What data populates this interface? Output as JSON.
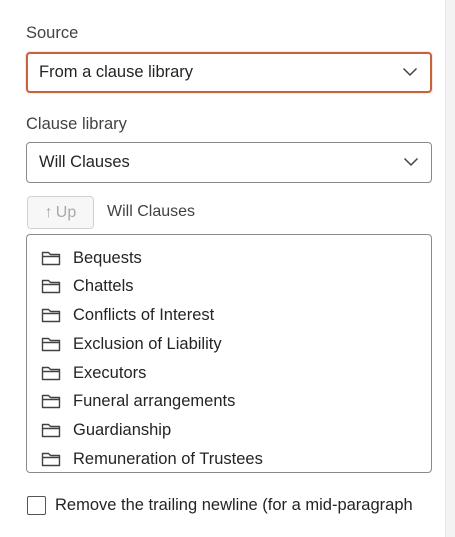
{
  "source": {
    "label": "Source",
    "selected": "From a clause library"
  },
  "clause_library": {
    "label": "Clause library",
    "selected": "Will Clauses"
  },
  "navigation": {
    "up_label": "Up",
    "up_arrow": "↑",
    "current_folder": "Will Clauses"
  },
  "folders": [
    "Bequests",
    "Chattels",
    "Conflicts of Interest",
    "Exclusion of Liability",
    "Executors",
    "Funeral arrangements",
    "Guardianship",
    "Remuneration of Trustees"
  ],
  "options": {
    "remove_trailing_newline": {
      "label": "Remove the trailing newline (for a mid-paragraph",
      "checked": false
    }
  },
  "icons": {
    "folder": "folder-icon",
    "dropdown": "chevron-down-icon"
  },
  "colors": {
    "focus_border": "#c8623b",
    "disabled_text": "#a8a8a8"
  }
}
